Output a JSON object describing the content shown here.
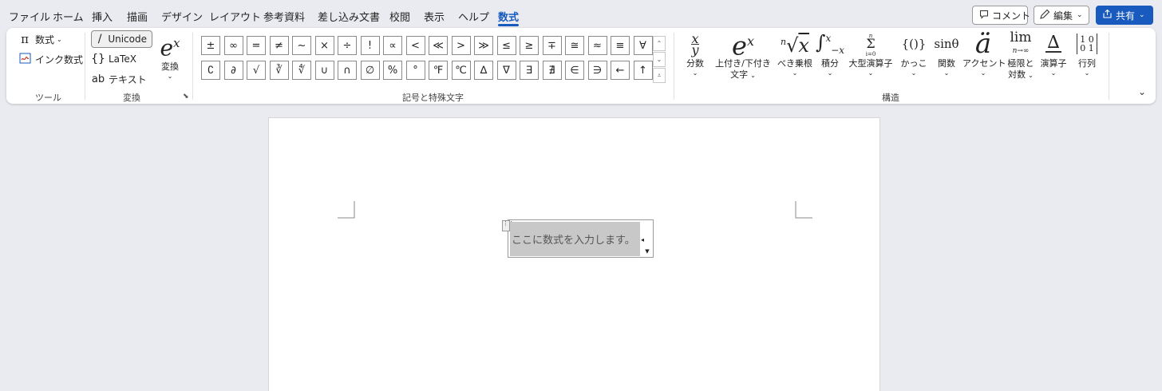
{
  "menu": {
    "tabs": [
      "ファイル",
      "ホーム",
      "挿入",
      "描画",
      "デザイン",
      "レイアウト",
      "参考資料",
      "差し込み文書",
      "校閲",
      "表示",
      "ヘルプ",
      "数式"
    ],
    "active_tab": "数式",
    "comment_label": "コメント",
    "edit_label": "編集",
    "share_label": "共有"
  },
  "ribbon": {
    "tools": {
      "equation_label": "数式",
      "ink_equation_label": "インク数式",
      "group_label": "ツール"
    },
    "conversions": {
      "unicode_label": "Unicode",
      "latex_label": "LaTeX",
      "text_label": "テキスト",
      "convert_label": "変換",
      "group_label": "変換"
    },
    "symbols": {
      "row1": [
        "±",
        "∞",
        "=",
        "≠",
        "~",
        "×",
        "÷",
        "!",
        "∝",
        "<",
        "≪",
        ">",
        "≫",
        "≤",
        "≥",
        "∓",
        "≅",
        "≈",
        "≡",
        "∀"
      ],
      "row2": [
        "∁",
        "∂",
        "√",
        "∛",
        "∜",
        "∪",
        "∩",
        "∅",
        "%",
        "°",
        "℉",
        "℃",
        "∆",
        "∇",
        "∃",
        "∄",
        "∈",
        "∋",
        "←",
        "↑"
      ],
      "group_label": "記号と特殊文字"
    },
    "structures": {
      "items": [
        {
          "label": "分数",
          "label2": "",
          "icon": "fraction-icon"
        },
        {
          "label": "上付き/下付き",
          "label2": "文字",
          "icon": "script-icon"
        },
        {
          "label": "べき乗根",
          "label2": "",
          "icon": "radical-icon"
        },
        {
          "label": "積分",
          "label2": "",
          "icon": "integral-icon"
        },
        {
          "label": "大型演算子",
          "label2": "",
          "icon": "large-operator-icon"
        },
        {
          "label": "かっこ",
          "label2": "",
          "icon": "bracket-icon"
        },
        {
          "label": "関数",
          "label2": "",
          "icon": "function-icon"
        },
        {
          "label": "アクセント",
          "label2": "",
          "icon": "accent-icon"
        },
        {
          "label": "極限と",
          "label2": "対数",
          "icon": "limit-icon"
        },
        {
          "label": "演算子",
          "label2": "",
          "icon": "operator-icon"
        },
        {
          "label": "行列",
          "label2": "",
          "icon": "matrix-icon"
        }
      ],
      "group_label": "構造"
    }
  },
  "document": {
    "equation_placeholder": "ここに数式を入力します。"
  }
}
